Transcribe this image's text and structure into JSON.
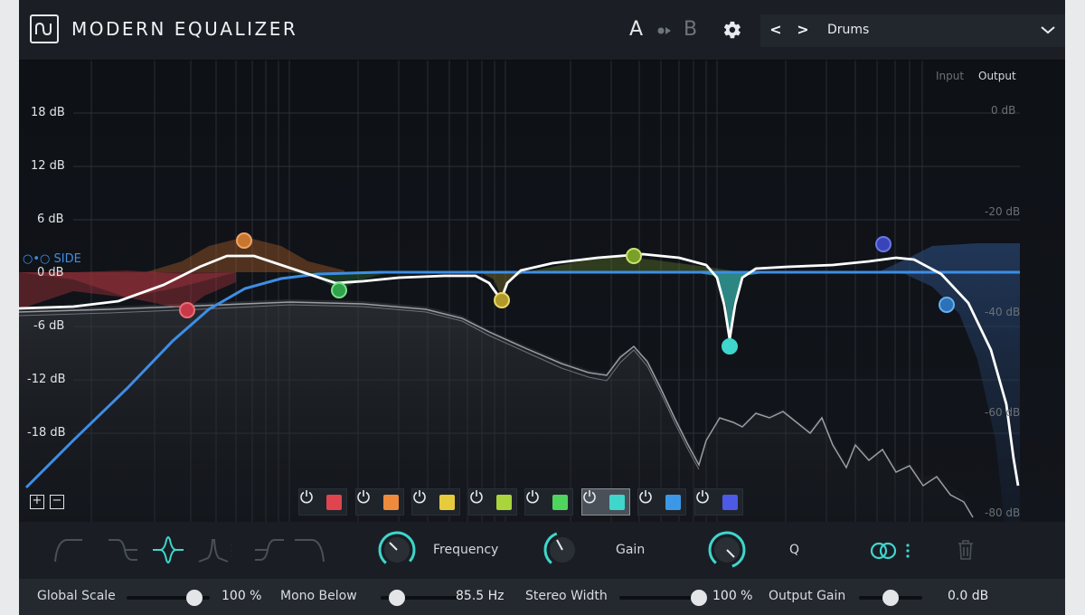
{
  "header": {
    "title": "MODERN EQUALIZER",
    "ab_a": "A",
    "ab_b": "B",
    "preset_prev": "<",
    "preset_next": ">",
    "preset_name": "Drums"
  },
  "graph": {
    "left_scale": [
      "18 dB",
      "12 dB",
      "6 dB",
      "0 dB",
      "-6 dB",
      "-12 dB",
      "-18 dB"
    ],
    "right_scale": [
      "0 dB",
      "-20 dB",
      "-40 dB",
      "-60 dB",
      "-80 dB"
    ],
    "meter_input_label": "Input",
    "meter_output_label": "Output",
    "side_label": "SIDE",
    "add_band": "+",
    "remove_band": "−"
  },
  "bands": [
    {
      "color": "#e0444e",
      "active": false
    },
    {
      "color": "#ee8a3c",
      "active": false
    },
    {
      "color": "#e6cb3c",
      "active": false
    },
    {
      "color": "#a9d43c",
      "active": false
    },
    {
      "color": "#4fd45e",
      "active": false
    },
    {
      "color": "#3fd6cc",
      "active": true
    },
    {
      "color": "#3c98e6",
      "active": false
    },
    {
      "color": "#4c5ae6",
      "active": false
    }
  ],
  "filter_shapes": [
    "low-cut-icon",
    "low-shelf-icon",
    "bell-icon",
    "notch-icon",
    "high-shelf-icon",
    "high-cut-icon"
  ],
  "selected_shape": "bell-icon",
  "knobs": {
    "frequency_label": "Frequency",
    "gain_label": "Gain",
    "q_label": "Q"
  },
  "bottom": {
    "global_scale_label": "Global Scale",
    "global_scale_value": "100 %",
    "global_scale_level": 0.82,
    "mono_below_label": "Mono Below",
    "mono_below_value": "85.5 Hz",
    "mono_below_level": 0.2,
    "stereo_width_label": "Stereo Width",
    "stereo_width_value": "100 %",
    "stereo_width_level": 1.0,
    "output_gain_label": "Output Gain",
    "output_gain_value": "0.0 dB",
    "output_gain_level": 0.5
  },
  "colors": {
    "accent": "#3fd6cc",
    "side_blue": "#3d8ee6"
  }
}
